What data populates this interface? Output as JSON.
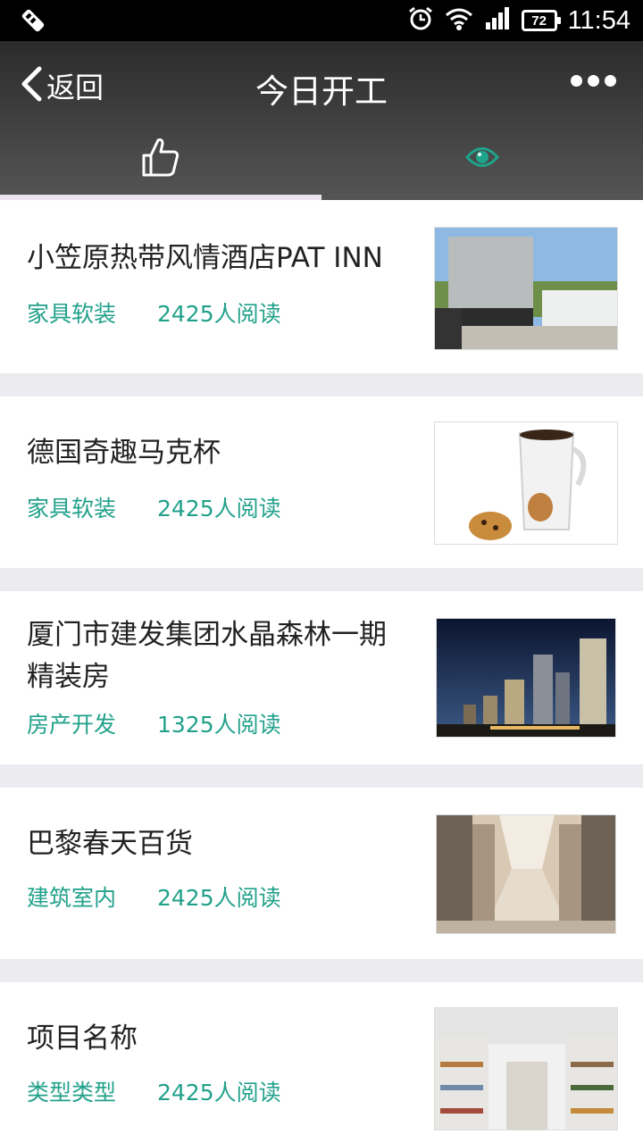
{
  "status_bar": {
    "time": "11:54",
    "battery": "72",
    "icons": [
      "usb-debug-icon",
      "alarm-icon",
      "wifi-icon",
      "signal-icon",
      "battery-icon"
    ]
  },
  "nav": {
    "back_label": "返回",
    "title": "今日开工",
    "more_icon": "more-dots-icon"
  },
  "tabs": [
    {
      "icon": "thumbs-up-icon",
      "active": true,
      "color": "#ffffff"
    },
    {
      "icon": "eye-icon",
      "active": false,
      "color": "#1fa48c"
    }
  ],
  "colors": {
    "accent": "#22a18b",
    "separator": "#ececf0",
    "title_text": "#222222",
    "navbar_top": "#2b2b2b",
    "navbar_bottom": "#555555"
  },
  "articles": [
    {
      "title": "小笠原热带风情酒店PAT INN",
      "category": "家具软装",
      "reads": "2425人阅读",
      "image": "hotel-building-photo"
    },
    {
      "title": "德国奇趣马克杯",
      "category": "家具软装",
      "reads": "2425人阅读",
      "image": "face-mug-cookie-photo"
    },
    {
      "title": "厦门市建发集团水晶森林一期精装房",
      "category": "房产开发",
      "reads": "1325人阅读",
      "image": "city-towers-night-photo"
    },
    {
      "title": "巴黎春天百货",
      "category": "建筑室内",
      "reads": "2425人阅读",
      "image": "mall-interior-photo"
    },
    {
      "title": "项目名称",
      "category": "类型类型",
      "reads": "2425人阅读",
      "image": "shop-shelves-photo"
    }
  ]
}
